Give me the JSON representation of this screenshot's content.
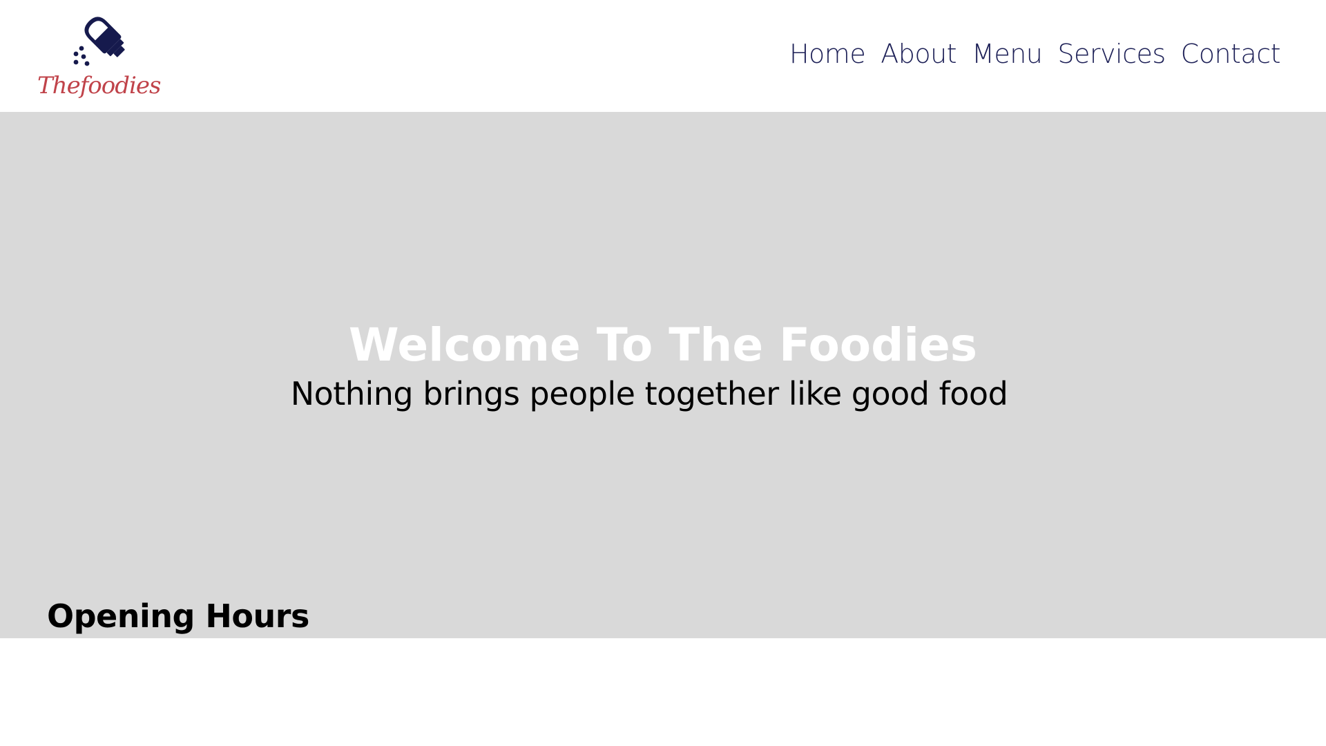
{
  "colors": {
    "page_background": "#ffffff",
    "hero_background": "#d9d9d9",
    "nav_text": "#1c1f56",
    "logo_icon": "#161a4d",
    "logo_text": "#c0434a",
    "hero_title": "#ffffff",
    "body_text": "#000000"
  },
  "header": {
    "logo": {
      "icon": "salt-shaker-icon",
      "text": "Thefoodies"
    },
    "nav": [
      {
        "label": "Home"
      },
      {
        "label": "About"
      },
      {
        "label": "Menu"
      },
      {
        "label": "Services"
      },
      {
        "label": "Contact"
      }
    ]
  },
  "hero": {
    "title": "Welcome To The Foodies",
    "subtitle": "Nothing brings people together like good food"
  },
  "sections": {
    "opening_hours_heading": "Opening Hours"
  }
}
